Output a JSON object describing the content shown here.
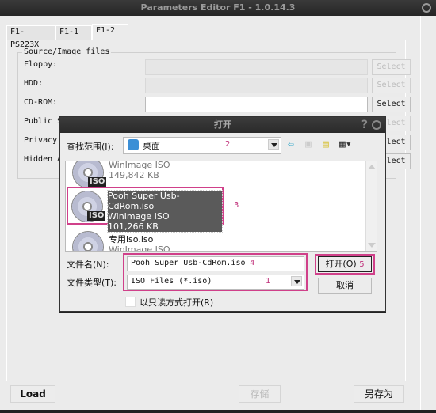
{
  "window": {
    "title": "Parameters Editor F1 - 1.0.14.3"
  },
  "tabs": [
    {
      "label": "F1-PS223X",
      "active": false
    },
    {
      "label": "F1-1",
      "active": false
    },
    {
      "label": "F1-2",
      "active": true
    }
  ],
  "group": {
    "legend": "Source/Image files",
    "rows": [
      {
        "label": "Floppy:",
        "value": "",
        "enabled": false,
        "button": "Select"
      },
      {
        "label": "HDD:",
        "value": "",
        "enabled": false,
        "button": "Select"
      },
      {
        "label": "CD-ROM:",
        "value": "",
        "enabled": true,
        "button": "Select"
      },
      {
        "label": "Public S",
        "value": "",
        "enabled": false,
        "button": "Select"
      },
      {
        "label": "Privacy",
        "value": "",
        "enabled": true,
        "button": "Select"
      },
      {
        "label": "Hidden A",
        "value": "",
        "enabled": true,
        "button": "Select"
      }
    ]
  },
  "bottom": {
    "load": "Load",
    "save": "存储",
    "save_as": "另存为"
  },
  "dialog": {
    "title": "打开",
    "help": "?",
    "look_in_label": "查找范围(I):",
    "look_in_value": "桌面",
    "toolbar_icons": [
      "back-icon",
      "up-folder-icon",
      "new-folder-icon",
      "view-menu-icon"
    ],
    "files": [
      {
        "name": "",
        "type": "WinImage ISO",
        "size": "149,842 KB",
        "selected": false
      },
      {
        "name": "Pooh Super Usb-CdRom.iso",
        "type": "WinImage ISO",
        "size": "101,266 KB",
        "selected": true
      },
      {
        "name": "专用iso.iso",
        "type": "WinImage ISO",
        "size": "",
        "selected": false
      }
    ],
    "filename_label": "文件名(N):",
    "filename_value": "Pooh Super Usb-CdRom.iso",
    "filetype_label": "文件类型(T):",
    "filetype_value": "ISO Files (*.iso)",
    "readonly_label": "以只读方式打开(R)",
    "open_button": "打开(O)",
    "cancel_button": "取消",
    "annotations": {
      "filetype": "1",
      "lookin": "2",
      "file": "3",
      "filename": "4",
      "open": "5"
    },
    "highlight_color": "#d0408a"
  }
}
